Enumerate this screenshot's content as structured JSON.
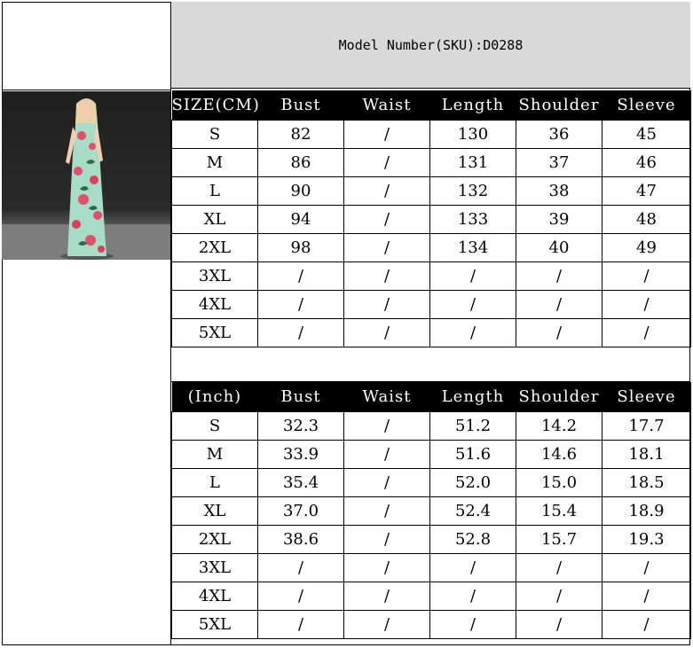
{
  "header": {
    "model_number": "Model Number(SKU):D0288"
  },
  "cm_table": {
    "columns": [
      "SIZE(CM)",
      "Bust",
      "Waist",
      "Length",
      "Shoulder",
      "Sleeve"
    ],
    "rows": [
      [
        "S",
        "82",
        "/",
        "130",
        "36",
        "45"
      ],
      [
        "M",
        "86",
        "/",
        "131",
        "37",
        "46"
      ],
      [
        "L",
        "90",
        "/",
        "132",
        "38",
        "47"
      ],
      [
        "XL",
        "94",
        "/",
        "133",
        "39",
        "48"
      ],
      [
        "2XL",
        "98",
        "/",
        "134",
        "40",
        "49"
      ],
      [
        "3XL",
        "/",
        "/",
        "/",
        "/",
        "/"
      ],
      [
        "4XL",
        "/",
        "/",
        "/",
        "/",
        "/"
      ],
      [
        "5XL",
        "/",
        "/",
        "/",
        "/",
        "/"
      ]
    ]
  },
  "inch_table": {
    "columns": [
      "(Inch)",
      "Bust",
      "Waist",
      "Length",
      "Shoulder",
      "Sleeve"
    ],
    "rows": [
      [
        "S",
        "32.3",
        "/",
        "51.2",
        "14.2",
        "17.7"
      ],
      [
        "M",
        "33.9",
        "/",
        "51.6",
        "14.6",
        "18.1"
      ],
      [
        "L",
        "35.4",
        "/",
        "52.0",
        "15.0",
        "18.5"
      ],
      [
        "XL",
        "37.0",
        "/",
        "52.4",
        "15.4",
        "18.9"
      ],
      [
        "2XL",
        "38.6",
        "/",
        "52.8",
        "15.7",
        "19.3"
      ],
      [
        "3XL",
        "/",
        "/",
        "/",
        "/",
        "/"
      ],
      [
        "4XL",
        "/",
        "/",
        "/",
        "/",
        "/"
      ],
      [
        "5XL",
        "/",
        "/",
        "/",
        "/",
        "/"
      ]
    ]
  },
  "colors": {
    "header_bg": "#d9d9d9",
    "table_header_bg": "#000000",
    "dress_mint": "#a8dcc8",
    "flower_pink": "#e0506a"
  }
}
